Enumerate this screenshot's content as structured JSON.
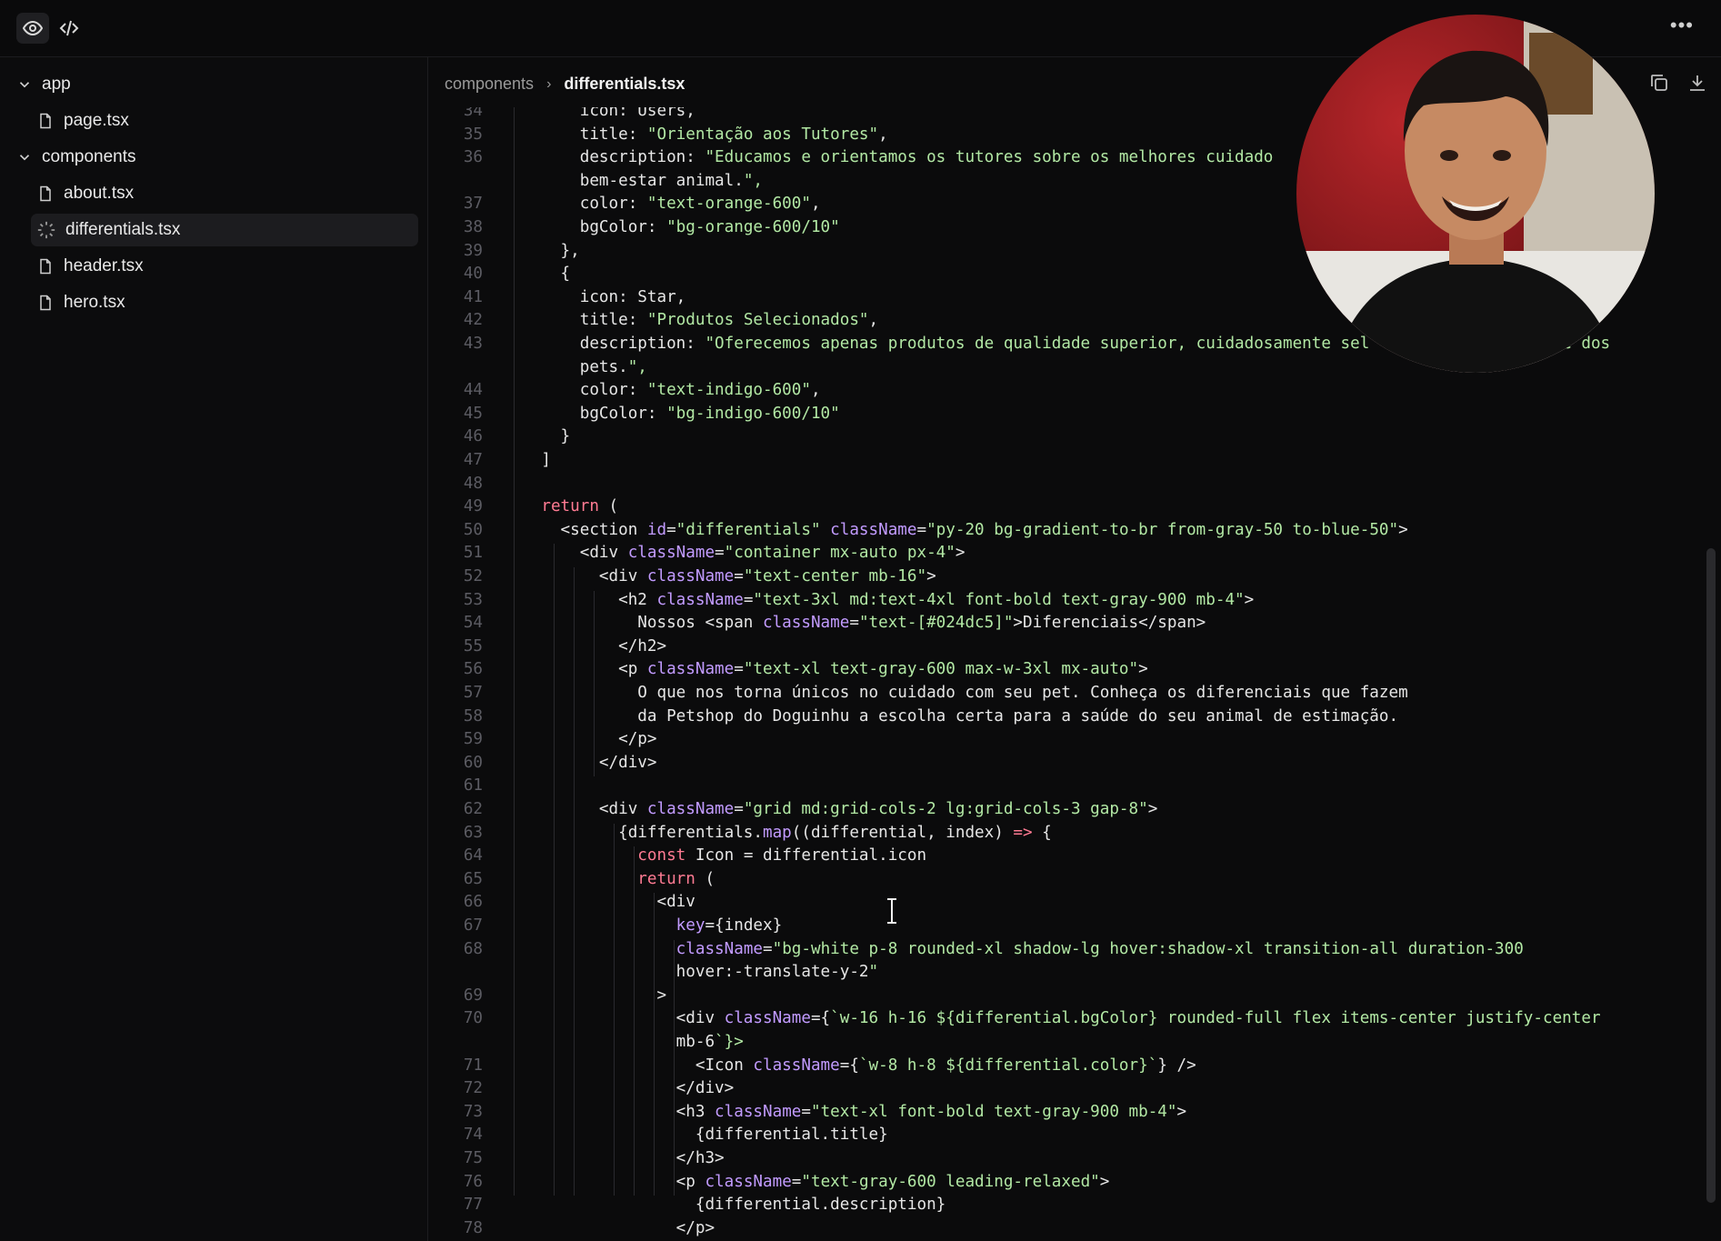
{
  "breadcrumb": {
    "folder": "components",
    "file": "differentials.tsx"
  },
  "more_menu_label": "•••",
  "tree": [
    {
      "kind": "folder",
      "label": "app"
    },
    {
      "kind": "file",
      "label": "page.tsx"
    },
    {
      "kind": "folder",
      "label": "components"
    },
    {
      "kind": "file",
      "label": "about.tsx"
    },
    {
      "kind": "file",
      "label": "differentials.tsx",
      "selected": true
    },
    {
      "kind": "file",
      "label": "header.tsx"
    },
    {
      "kind": "file",
      "label": "hero.tsx"
    }
  ],
  "code_lines": [
    {
      "n": "34",
      "t": "        icon: Users,"
    },
    {
      "n": "35",
      "t": "        title: \"Orientação aos Tutores\","
    },
    {
      "n": "36",
      "t": "        description: \"Educamos e orientamos os tutores sobre os melhores cuidado"
    },
    {
      "n": "",
      "t": "        bem-estar animal.\","
    },
    {
      "n": "37",
      "t": "        color: \"text-orange-600\","
    },
    {
      "n": "38",
      "t": "        bgColor: \"bg-orange-600/10\""
    },
    {
      "n": "39",
      "t": "      },"
    },
    {
      "n": "40",
      "t": "      {"
    },
    {
      "n": "41",
      "t": "        icon: Star,"
    },
    {
      "n": "42",
      "t": "        title: \"Produtos Selecionados\","
    },
    {
      "n": "43",
      "t": "        description: \"Oferecemos apenas produtos de qualidade superior, cuidadosamente sel              a saúde dos"
    },
    {
      "n": "",
      "t": "        pets.\","
    },
    {
      "n": "44",
      "t": "        color: \"text-indigo-600\","
    },
    {
      "n": "45",
      "t": "        bgColor: \"bg-indigo-600/10\""
    },
    {
      "n": "46",
      "t": "      }"
    },
    {
      "n": "47",
      "t": "    ]"
    },
    {
      "n": "48",
      "t": ""
    },
    {
      "n": "49",
      "t": "    return ("
    },
    {
      "n": "50",
      "t": "      <section id=\"differentials\" className=\"py-20 bg-gradient-to-br from-gray-50 to-blue-50\">"
    },
    {
      "n": "51",
      "t": "        <div className=\"container mx-auto px-4\">"
    },
    {
      "n": "52",
      "t": "          <div className=\"text-center mb-16\">"
    },
    {
      "n": "53",
      "t": "            <h2 className=\"text-3xl md:text-4xl font-bold text-gray-900 mb-4\">"
    },
    {
      "n": "54",
      "t": "              Nossos <span className=\"text-[#024dc5]\">Diferenciais</span>"
    },
    {
      "n": "55",
      "t": "            </h2>"
    },
    {
      "n": "56",
      "t": "            <p className=\"text-xl text-gray-600 max-w-3xl mx-auto\">"
    },
    {
      "n": "57",
      "t": "              O que nos torna únicos no cuidado com seu pet. Conheça os diferenciais que fazem"
    },
    {
      "n": "58",
      "t": "              da Petshop do Doguinhu a escolha certa para a saúde do seu animal de estimação."
    },
    {
      "n": "59",
      "t": "            </p>"
    },
    {
      "n": "60",
      "t": "          </div>"
    },
    {
      "n": "61",
      "t": ""
    },
    {
      "n": "62",
      "t": "          <div className=\"grid md:grid-cols-2 lg:grid-cols-3 gap-8\">"
    },
    {
      "n": "63",
      "t": "            {differentials.map((differential, index) => {"
    },
    {
      "n": "64",
      "t": "              const Icon = differential.icon"
    },
    {
      "n": "65",
      "t": "              return ("
    },
    {
      "n": "66",
      "t": "                <div"
    },
    {
      "n": "67",
      "t": "                  key={index}"
    },
    {
      "n": "68",
      "t": "                  className=\"bg-white p-8 rounded-xl shadow-lg hover:shadow-xl transition-all duration-300"
    },
    {
      "n": "",
      "t": "                  hover:-translate-y-2\""
    },
    {
      "n": "69",
      "t": "                >"
    },
    {
      "n": "70",
      "t": "                  <div className={`w-16 h-16 ${differential.bgColor} rounded-full flex items-center justify-center"
    },
    {
      "n": "",
      "t": "                  mb-6`}>"
    },
    {
      "n": "71",
      "t": "                    <Icon className={`w-8 h-8 ${differential.color}`} />"
    },
    {
      "n": "72",
      "t": "                  </div>"
    },
    {
      "n": "73",
      "t": "                  <h3 className=\"text-xl font-bold text-gray-900 mb-4\">"
    },
    {
      "n": "74",
      "t": "                    {differential.title}"
    },
    {
      "n": "75",
      "t": "                  </h3>"
    },
    {
      "n": "76",
      "t": "                  <p className=\"text-gray-600 leading-relaxed\">"
    },
    {
      "n": "77",
      "t": "                    {differential.description}"
    },
    {
      "n": "78",
      "t": "                  </p>"
    }
  ],
  "icons": {
    "preview": "eye-icon",
    "code": "code-icon",
    "more": "more-icon",
    "copy": "copy-icon",
    "download": "download-icon",
    "file": "file-icon",
    "chevron": "chevron-down-icon",
    "loading": "spinner-icon"
  },
  "colors": {
    "background": "#0b0b0c",
    "keyword": "#ff7b93",
    "string": "#b2e8a4",
    "attribute": "#c29bff",
    "line_number": "#5c5c63"
  }
}
